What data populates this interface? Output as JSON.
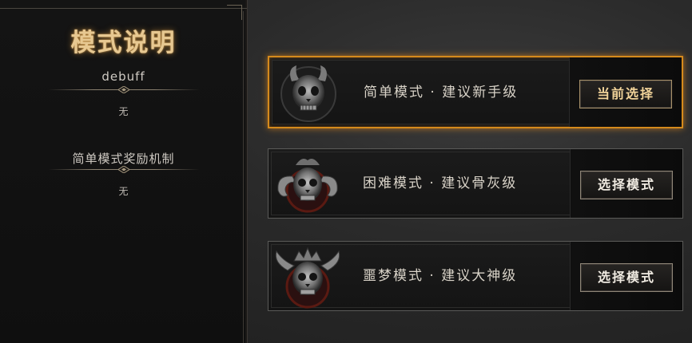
{
  "left_panel": {
    "title": "模式说明",
    "debuff_heading": "debuff",
    "debuff_value": "无",
    "reward_heading": "简单模式奖励机制",
    "reward_value": "无"
  },
  "modes": [
    {
      "label": "简单模式 · 建议新手级",
      "button": "当前选择",
      "selected": true,
      "skull_icon": "horned-skull-icon"
    },
    {
      "label": "困难模式 · 建议骨灰级",
      "button": "选择模式",
      "selected": false,
      "skull_icon": "ram-horned-skull-icon"
    },
    {
      "label": "噩梦模式 · 建议大神级",
      "button": "选择模式",
      "selected": false,
      "skull_icon": "demon-skull-icon"
    }
  ],
  "colors": {
    "accent_gold": "#e7c891",
    "selected_border": "#d58a1c",
    "panel_bg": "#121212",
    "card_border": "#5a5a58"
  }
}
